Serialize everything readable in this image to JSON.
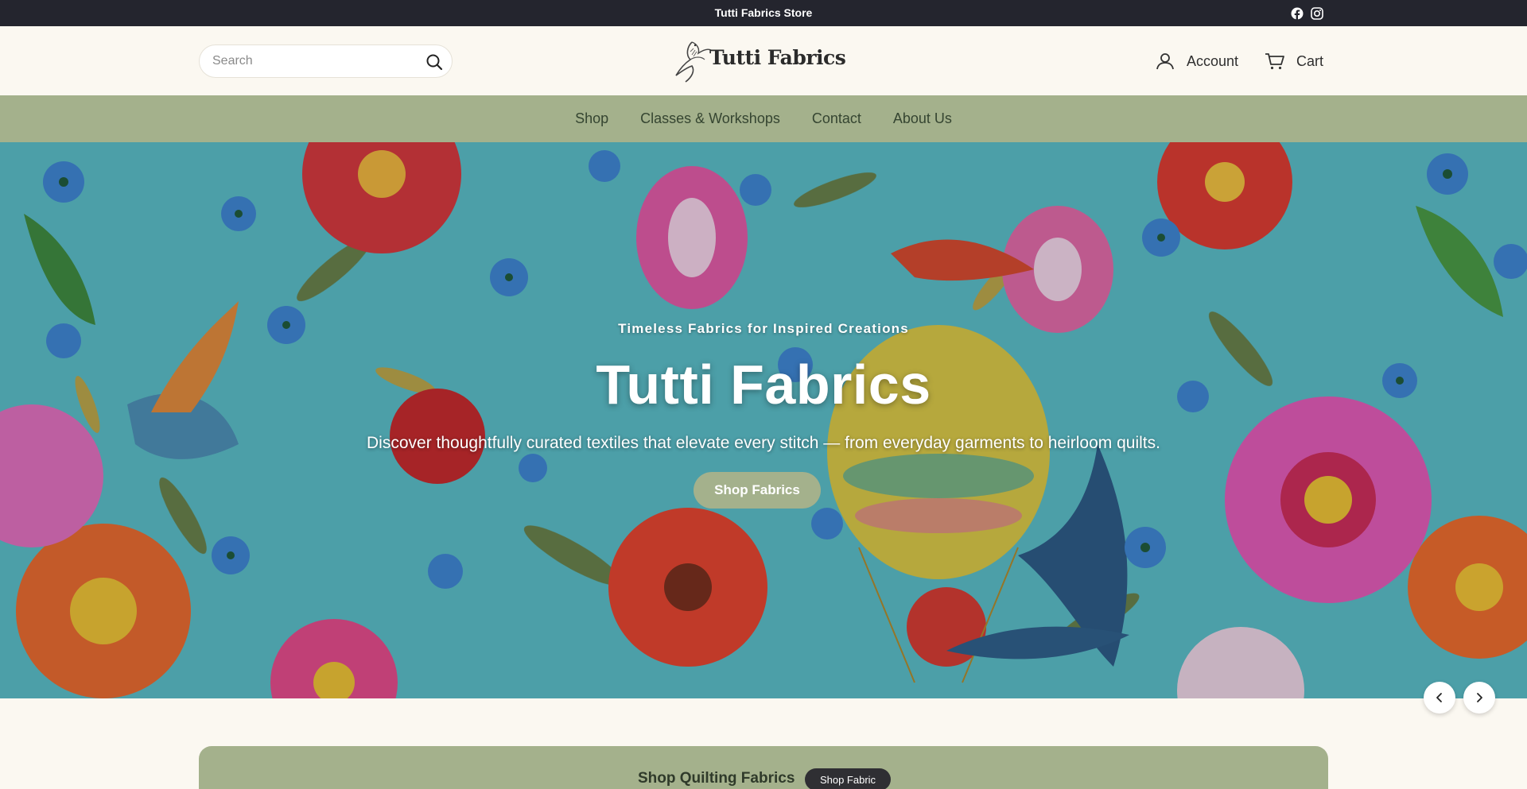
{
  "announcement": {
    "text": "Tutti Fabrics Store"
  },
  "social": {
    "facebook_icon": "facebook-icon",
    "instagram_icon": "instagram-icon"
  },
  "header": {
    "search_placeholder": "Search",
    "logo_text": "Tutti Fabrics",
    "account_label": "Account",
    "cart_label": "Cart"
  },
  "nav": {
    "items": [
      "Shop",
      "Classes & Workshops",
      "Contact",
      "About Us"
    ]
  },
  "hero": {
    "eyebrow": "Timeless Fabrics for Inspired Creations",
    "title": "Tutti Fabrics",
    "subtitle": "Discover thoughtfully curated textiles that elevate every stitch — from everyday garments to heirloom quilts.",
    "cta_label": "Shop Fabrics"
  },
  "promo": {
    "label": "Shop Quilting Fabrics",
    "button_label": "Shop Fabric"
  },
  "colors": {
    "topbar": "#24252e",
    "nav": "#a4b18c",
    "background": "#fbf8f1",
    "hero_base": "#5bbdc7"
  }
}
